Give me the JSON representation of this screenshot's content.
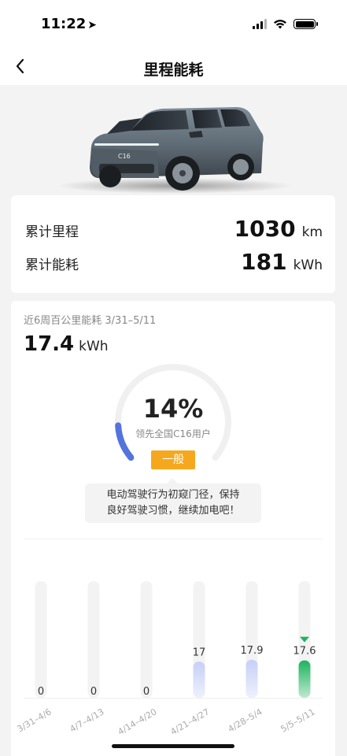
{
  "status": {
    "time": "11:22"
  },
  "nav": {
    "title": "里程能耗"
  },
  "totals": {
    "mileage_label": "累计里程",
    "mileage_value": "1030",
    "mileage_unit": "km",
    "energy_label": "累计能耗",
    "energy_value": "181",
    "energy_unit": "kWh"
  },
  "hero": {
    "plate_text": "C16"
  },
  "summary": {
    "period": "近6周百公里能耗 3/31–5/11",
    "avg_value": "17.4",
    "avg_unit": "kWh",
    "percent": "14%",
    "percent_caption": "领先全国C16用户",
    "grade": "一般",
    "tip_line1": "电动驾驶行为初窥门径，保持",
    "tip_line2": "良好驾驶习惯，继续加电吧！",
    "percent_value": 0.14
  },
  "chart_data": {
    "type": "bar",
    "categories": [
      "3/31–4/6",
      "4/7–4/13",
      "4/14–4/20",
      "4/21–4/27",
      "4/28–5/4",
      "5/5–5/11"
    ],
    "values": [
      0,
      0,
      0,
      17,
      17.9,
      17.6
    ],
    "labels": [
      "0",
      "0",
      "0",
      "17",
      "17.9",
      "17.6"
    ],
    "selected_index": 5,
    "ylim": [
      0,
      55
    ],
    "colors": {
      "normal": "#cdd5f7",
      "selected": "#1db35e",
      "track": "#f3f3f3",
      "gauge": "#5373de"
    }
  }
}
